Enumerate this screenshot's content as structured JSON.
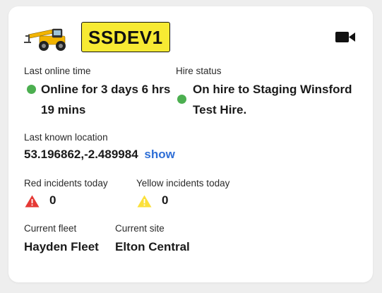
{
  "vehicle": {
    "image_icon": "telehandler-vehicle-icon",
    "registration": "SSDEV1",
    "plate_color": "#f7ea33"
  },
  "header": {
    "video_icon": "video-camera-icon"
  },
  "last_online": {
    "label": "Last online time",
    "status_color": "#4caf50",
    "line1": "Online for 3 days 6 hrs",
    "line2": "19 mins"
  },
  "hire": {
    "label": "Hire status",
    "status_color": "#4caf50",
    "line1": "On hire to Staging Winsford",
    "line2": "Test Hire."
  },
  "location": {
    "label": "Last known location",
    "coordinates": "53.196862,-2.489984",
    "show_label": "show",
    "link_color": "#2f6fd6"
  },
  "incidents": {
    "red_label": "Red incidents today",
    "red_icon": "red-warning-triangle-icon",
    "red_color": "#e53935",
    "red_count": "0",
    "yellow_label": "Yellow incidents today",
    "yellow_icon": "yellow-warning-triangle-icon",
    "yellow_color": "#fbe03a",
    "yellow_count": "0"
  },
  "fleet": {
    "label": "Current fleet",
    "value": "Hayden Fleet"
  },
  "site": {
    "label": "Current site",
    "value": "Elton Central"
  }
}
